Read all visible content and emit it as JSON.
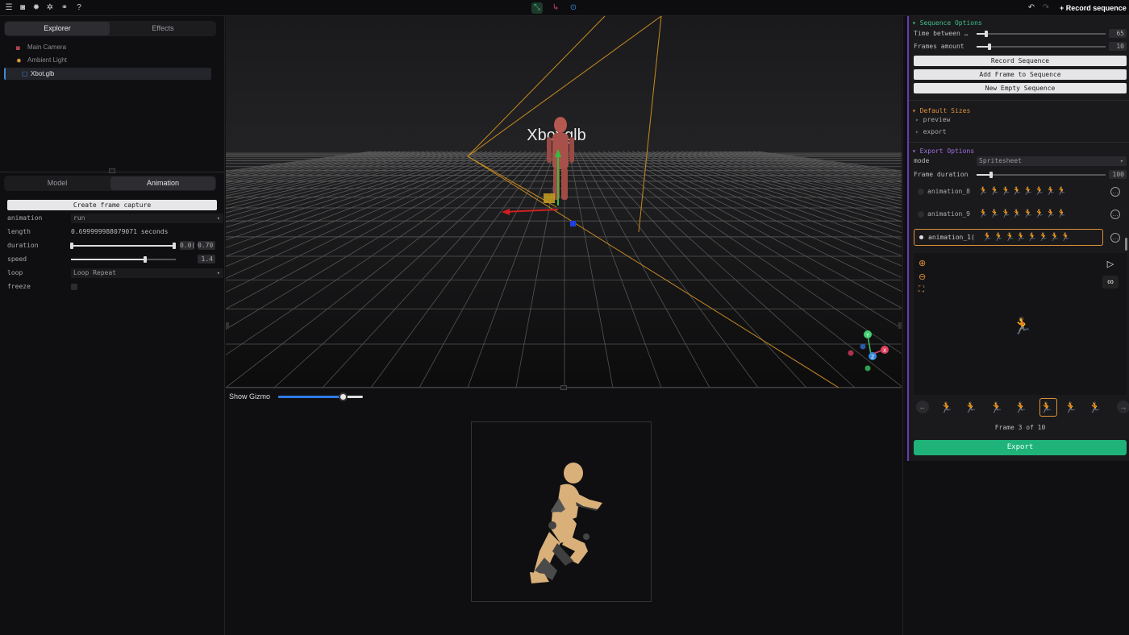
{
  "topbar": {
    "icons": [
      "menu-icon",
      "camera-icon",
      "sun-icon",
      "sparkle-icon",
      "link-icon",
      "help-icon"
    ],
    "center_icons": [
      "move-icon",
      "rotate-icon",
      "scale-icon"
    ],
    "record_label": "Record sequence"
  },
  "explorer": {
    "tabs": [
      "Explorer",
      "Effects"
    ],
    "items": [
      {
        "label": "Main Camera",
        "icon": "camera-icon"
      },
      {
        "label": "Ambient Light",
        "icon": "sun-icon"
      },
      {
        "label": "Xbot.glb",
        "icon": "cube-icon"
      }
    ]
  },
  "props": {
    "tabs": [
      "Model",
      "Animation"
    ],
    "capture_label": "Create frame capture",
    "rows": {
      "animation_label": "animation",
      "animation_value": "run",
      "length_label": "length",
      "length_value": "0.699999988079071 seconds",
      "duration_label": "duration",
      "duration_min": "0.0(",
      "duration_max": "0.70",
      "speed_label": "speed",
      "speed_value": "1.4",
      "loop_label": "loop",
      "loop_value": "Loop Repeat",
      "freeze_label": "freeze"
    }
  },
  "viewport": {
    "model_label": "Xbot.glb"
  },
  "bottom": {
    "gizmo_label": "Show Gizmo",
    "gizmo_value": 0.78
  },
  "sequence": {
    "title": "Sequence Options",
    "time_label": "Time between …",
    "time_value": "65",
    "frames_label": "Frames amount",
    "frames_value": "10",
    "record_btn": "Record Sequence",
    "add_btn": "Add Frame to Sequence",
    "new_btn": "New Empty Sequence"
  },
  "sizes": {
    "title": "Default Sizes",
    "items": [
      "preview",
      "export"
    ]
  },
  "export": {
    "title": "Export Options",
    "mode_label": "mode",
    "mode_value": "Spritesheet",
    "duration_label": "Frame duration",
    "duration_value": "100",
    "animations": [
      "animation_8",
      "animation_9",
      "animation_1("
    ],
    "frame_status": "Frame 3 of 10",
    "export_btn": "Export"
  },
  "colors": {
    "accent_green": "#1fb37a",
    "section_green": "#3fc08a",
    "section_orange": "#e0903a",
    "section_purple": "#a070e0",
    "highlight_orange": "#e0903a",
    "slider_blue": "#2f7be6"
  }
}
